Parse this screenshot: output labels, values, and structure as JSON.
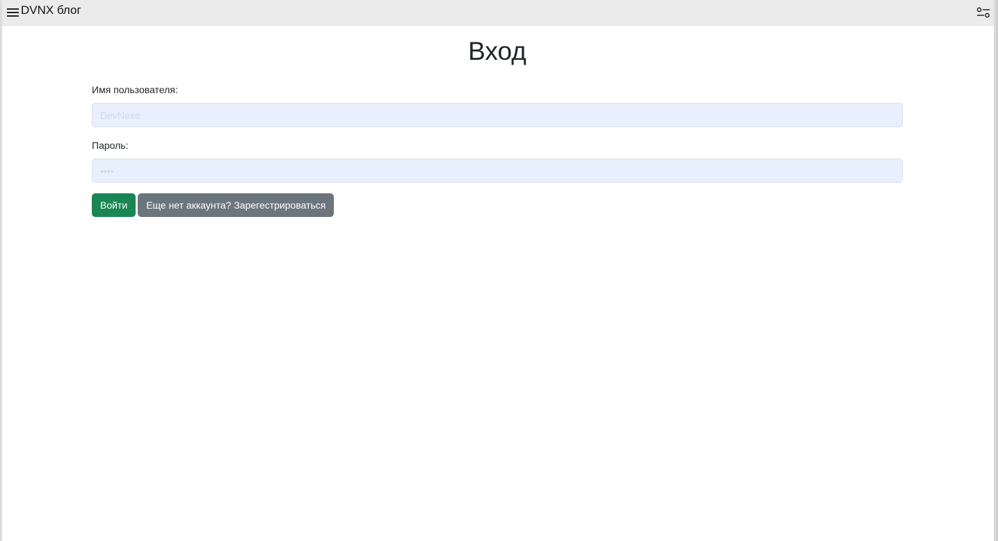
{
  "header": {
    "app_title": "DVNX блог",
    "menu_icon": "hamburger-menu-icon",
    "settings_icon": "settings-sliders-icon"
  },
  "login": {
    "title": "Вход",
    "username_label": "Имя пользователя:",
    "username_value": "DevNexe",
    "password_label": "Пароль:",
    "password_value": "••••",
    "login_button": "Войти",
    "register_button": "Еще нет аккаунта? Зарегестрироваться"
  },
  "colors": {
    "login_button": "#198754",
    "register_button": "#6c757d",
    "input_background": "#e8f0fe",
    "topbar_background": "#ebebeb"
  }
}
